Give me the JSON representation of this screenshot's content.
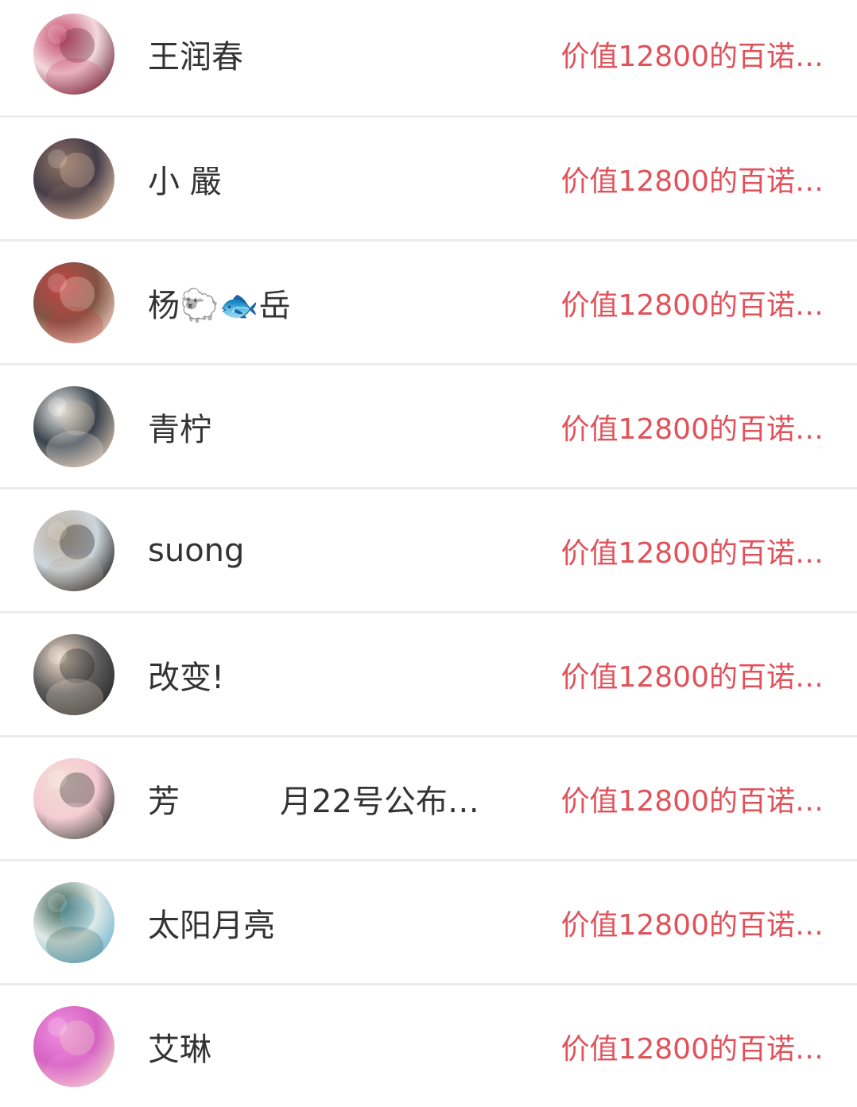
{
  "rows": [
    {
      "name": "王润春",
      "note": "",
      "gift": "价值12800的百诺…",
      "avatar": {
        "icon": "avatar-flowers",
        "colors": [
          "#f1d7dc",
          "#c23a5c",
          "#6b2a3b"
        ]
      }
    },
    {
      "name": "小 嚴",
      "note": "",
      "gift": "价值12800的百诺…",
      "avatar": {
        "icon": "avatar-baby",
        "colors": [
          "#3b3340",
          "#8a6a5a",
          "#d9b7a0"
        ]
      }
    },
    {
      "name": "杨🐑🐟岳",
      "note": "",
      "gift": "价值12800的百诺…",
      "avatar": {
        "icon": "avatar-red-text",
        "colors": [
          "#7b4a3a",
          "#c23a3a",
          "#e7c7b5"
        ]
      }
    },
    {
      "name": "青柠",
      "note": "",
      "gift": "价值12800的百诺…",
      "avatar": {
        "icon": "avatar-girl",
        "colors": [
          "#2f3a44",
          "#f2f0ea",
          "#cbb6a4"
        ]
      }
    },
    {
      "name": "suong",
      "note": "",
      "gift": "价值12800的百诺…",
      "avatar": {
        "icon": "avatar-beach",
        "colors": [
          "#c9d3da",
          "#b8a895",
          "#1f1f1f"
        ]
      }
    },
    {
      "name": "改变!",
      "note": "",
      "gift": "价值12800的百诺…",
      "avatar": {
        "icon": "avatar-face",
        "colors": [
          "#555",
          "#f3dbc8",
          "#1e1e1e"
        ]
      }
    },
    {
      "name": "芳",
      "note": "月22号公布…",
      "gift": "价值12800的百诺…",
      "avatar": {
        "icon": "avatar-pink-face",
        "colors": [
          "#f3c7d0",
          "#f4ddd3",
          "#2c2c2c"
        ]
      }
    },
    {
      "name": "太阳月亮",
      "note": "",
      "gift": "价值12800的百诺…",
      "avatar": {
        "icon": "avatar-landscape",
        "colors": [
          "#dfe9e6",
          "#2f5a4a",
          "#6bb4cf"
        ]
      }
    },
    {
      "name": "艾琳",
      "note": "",
      "gift": "价值12800的百诺…",
      "avatar": {
        "icon": "avatar-pink-room",
        "colors": [
          "#d35bbf",
          "#f08adf",
          "#f1d2c7"
        ]
      }
    }
  ]
}
